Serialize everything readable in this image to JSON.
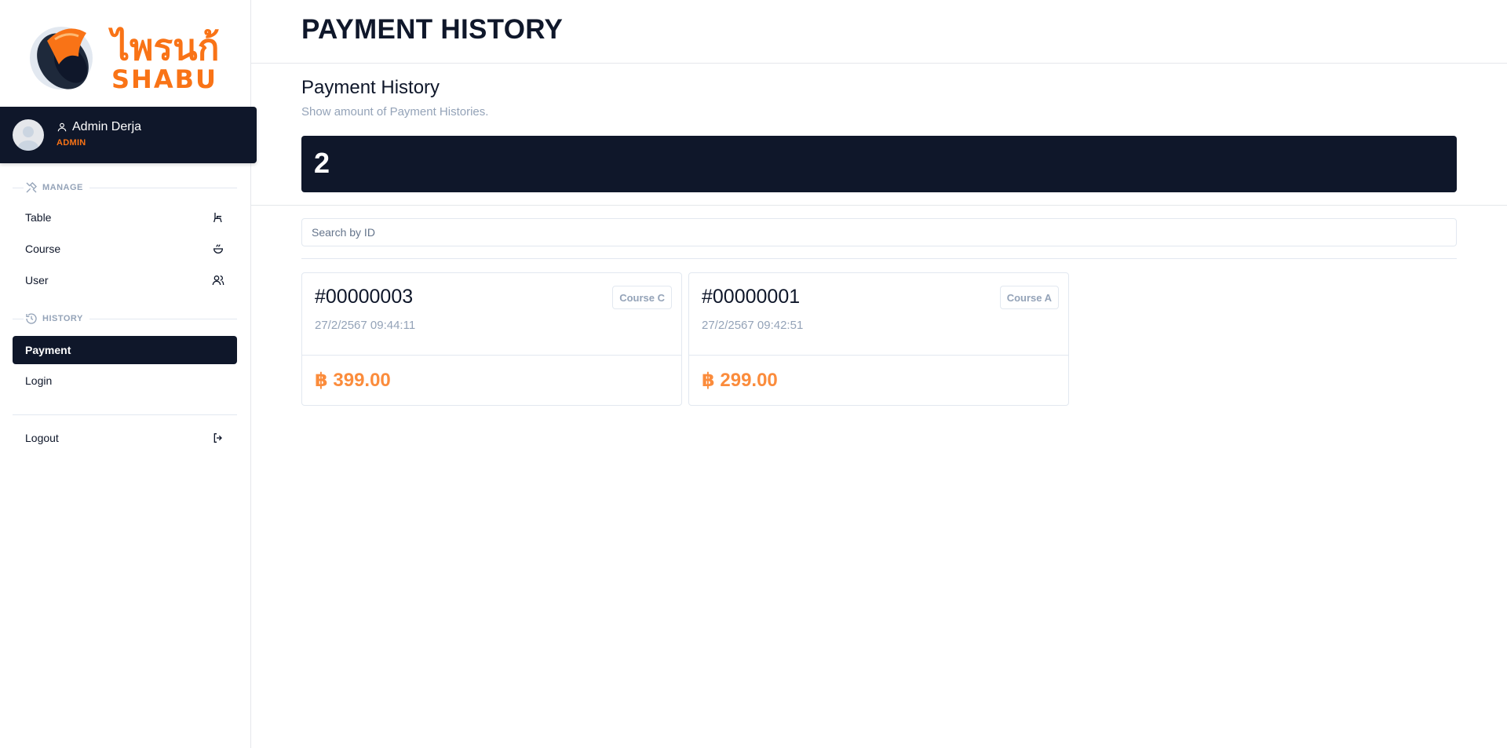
{
  "brand": {
    "logo_line1": "ไพรนก้น",
    "logo_line2": "SHABU",
    "colors": {
      "navy": "#0f172a",
      "orange": "#f97316"
    }
  },
  "profile": {
    "name": "Admin Derja",
    "role": "ADMIN",
    "avatar_icon": "user-avatar-icon"
  },
  "sidebar": {
    "manage_label": "MANAGE",
    "manage_items": [
      {
        "label": "Table",
        "icon": "table-chair-icon"
      },
      {
        "label": "Course",
        "icon": "bowl-icon"
      },
      {
        "label": "User",
        "icon": "users-icon"
      }
    ],
    "history_label": "HISTORY",
    "history_items": [
      {
        "label": "Payment",
        "active": true
      },
      {
        "label": "Login",
        "active": false
      }
    ],
    "logout_label": "Logout"
  },
  "header": {
    "title": "PAYMENT HISTORY"
  },
  "stat": {
    "title": "Payment History",
    "description": "Show amount of Payment Histories.",
    "value": "2"
  },
  "search": {
    "placeholder": "Search by ID",
    "value": ""
  },
  "payments": [
    {
      "id": "#00000003",
      "datetime": "27/2/2567 09:44:11",
      "course": "Course C",
      "amount": "฿ 399.00"
    },
    {
      "id": "#00000001",
      "datetime": "27/2/2567 09:42:51",
      "course": "Course A",
      "amount": "฿ 299.00"
    }
  ]
}
